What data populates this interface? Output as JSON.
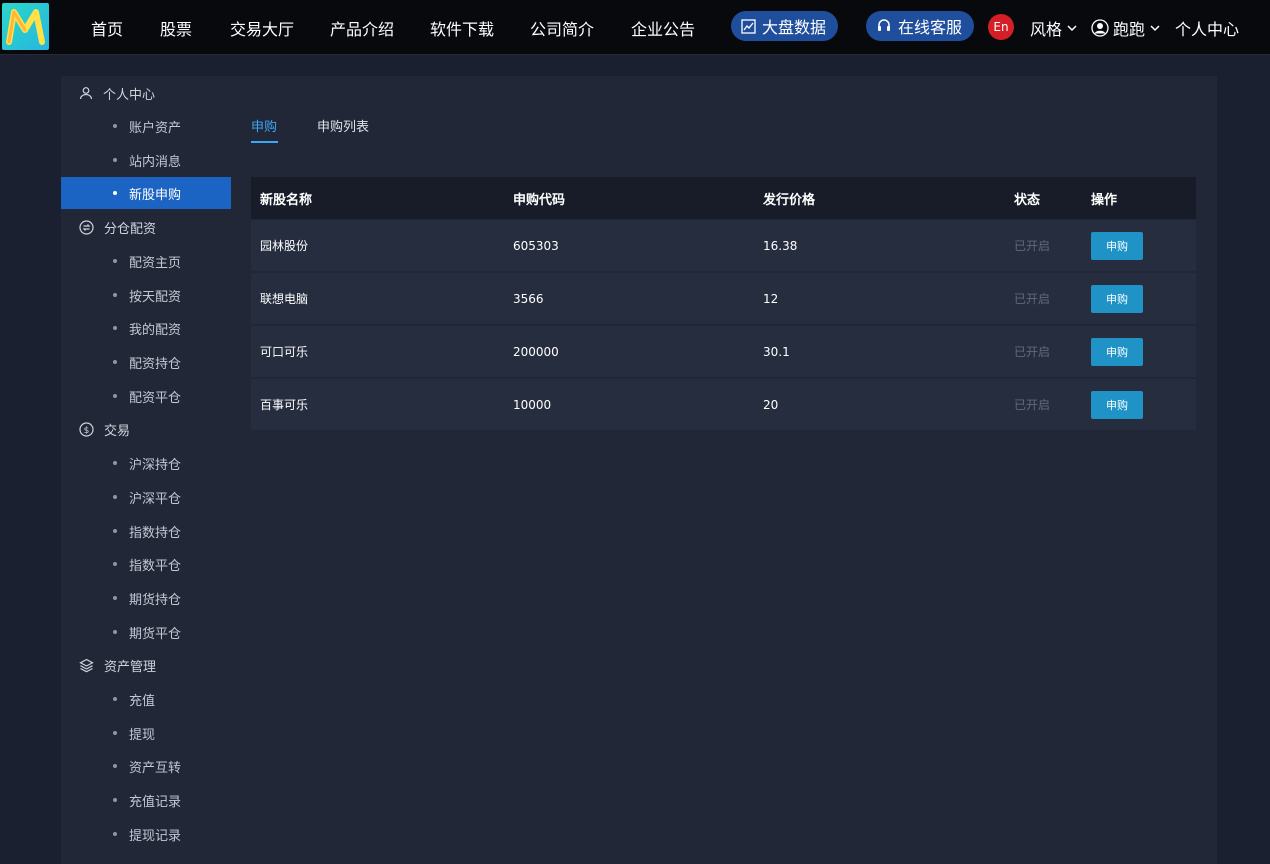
{
  "brand": {
    "logo_letter": "M"
  },
  "nav": {
    "items": [
      {
        "label": "首页"
      },
      {
        "label": "股票"
      },
      {
        "label": "交易大厅"
      },
      {
        "label": "产品介绍"
      },
      {
        "label": "软件下载"
      },
      {
        "label": "公司简介"
      },
      {
        "label": "企业公告"
      }
    ],
    "big_data_label": "大盘数据",
    "service_label": "在线客服",
    "lang_label": "En",
    "style_label": "风格",
    "user_label": "跑跑",
    "personal_center_label": "个人中心",
    "colors": {
      "pill": "#1f4f9c",
      "lang_badge": "#d41f26",
      "accent": "#3da6f5",
      "active_menu": "#1b64c4",
      "button": "#1f93c6"
    }
  },
  "sidebar": {
    "groups": [
      {
        "label": "个人中心",
        "icon": "user-icon",
        "items": [
          {
            "label": "账户资产"
          },
          {
            "label": "站内消息"
          },
          {
            "label": "新股申购",
            "active": true
          }
        ]
      },
      {
        "label": "分仓配资",
        "icon": "exchange-icon",
        "items": [
          {
            "label": "配资主页"
          },
          {
            "label": "按天配资"
          },
          {
            "label": "我的配资"
          },
          {
            "label": "配资持仓"
          },
          {
            "label": "配资平仓"
          }
        ]
      },
      {
        "label": "交易",
        "icon": "dollar-circle-icon",
        "items": [
          {
            "label": "沪深持仓"
          },
          {
            "label": "沪深平仓"
          },
          {
            "label": "指数持仓"
          },
          {
            "label": "指数平仓"
          },
          {
            "label": "期货持仓"
          },
          {
            "label": "期货平仓"
          }
        ]
      },
      {
        "label": "资产管理",
        "icon": "layers-icon",
        "items": [
          {
            "label": "充值"
          },
          {
            "label": "提现"
          },
          {
            "label": "资产互转"
          },
          {
            "label": "充值记录"
          },
          {
            "label": "提现记录"
          }
        ]
      }
    ]
  },
  "tabs": [
    {
      "label": "申购",
      "active": true
    },
    {
      "label": "申购列表"
    }
  ],
  "table": {
    "headers": [
      "新股名称",
      "申购代码",
      "发行价格",
      "状态",
      "操作"
    ],
    "rows": [
      {
        "name": "园林股份",
        "code": "605303",
        "price": "16.38",
        "status": "已开启",
        "action": "申购"
      },
      {
        "name": "联想电脑",
        "code": "3566",
        "price": "12",
        "status": "已开启",
        "action": "申购"
      },
      {
        "name": "可口可乐",
        "code": "200000",
        "price": "30.1",
        "status": "已开启",
        "action": "申购"
      },
      {
        "name": "百事可乐",
        "code": "10000",
        "price": "20",
        "status": "已开启",
        "action": "申购"
      }
    ]
  }
}
